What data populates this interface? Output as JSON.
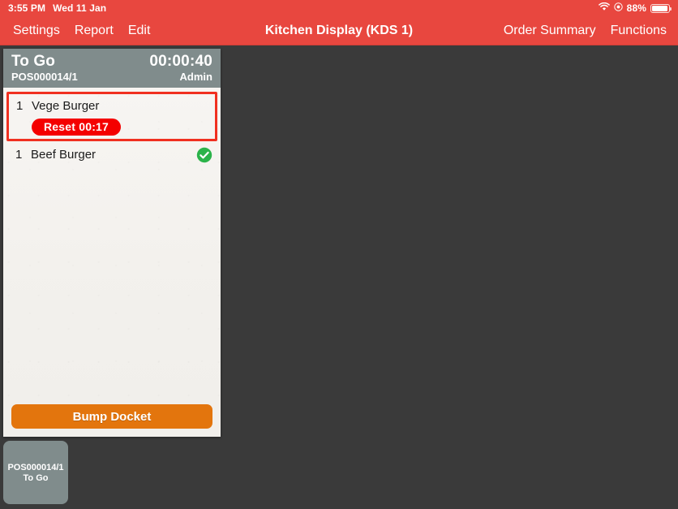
{
  "status_bar": {
    "time": "3:55 PM",
    "date": "Wed 11 Jan",
    "wifi_icon": "wifi-icon",
    "lock_icon": "rotation-lock-icon",
    "battery_percent": "88%",
    "battery_icon": "battery-icon"
  },
  "nav_bar": {
    "title": "Kitchen Display (KDS 1)",
    "left_items": [
      {
        "label": "Settings",
        "name": "nav-button-settings"
      },
      {
        "label": "Report",
        "name": "nav-button-report"
      },
      {
        "label": "Edit",
        "name": "nav-button-edit"
      }
    ],
    "right_items": [
      {
        "label": "Order Summary",
        "name": "nav-button-order-summary"
      },
      {
        "label": "Functions",
        "name": "nav-button-functions"
      }
    ]
  },
  "docket": {
    "order_type": "To Go",
    "timer": "00:00:40",
    "reference": "POS000014/1",
    "user": "Admin",
    "items": [
      {
        "qty": "1",
        "name": "Vege Burger",
        "selected": true,
        "reset_label": "Reset 00:17",
        "completed": false
      },
      {
        "qty": "1",
        "name": "Beef Burger",
        "selected": false,
        "reset_label": "",
        "completed": true
      }
    ],
    "bump_label": "Bump Docket"
  },
  "tray": {
    "tiles": [
      {
        "reference": "POS000014/1",
        "order_type": "To Go"
      }
    ]
  },
  "colors": {
    "brand_red": "#e8473f",
    "header_gray": "#808c8c",
    "background_dark": "#3a3a3a",
    "paper": "#f4f2ef",
    "bump_orange": "#e3750d",
    "selection_red": "#f03020",
    "reset_red": "#f40000",
    "complete_green": "#2bb34a"
  }
}
